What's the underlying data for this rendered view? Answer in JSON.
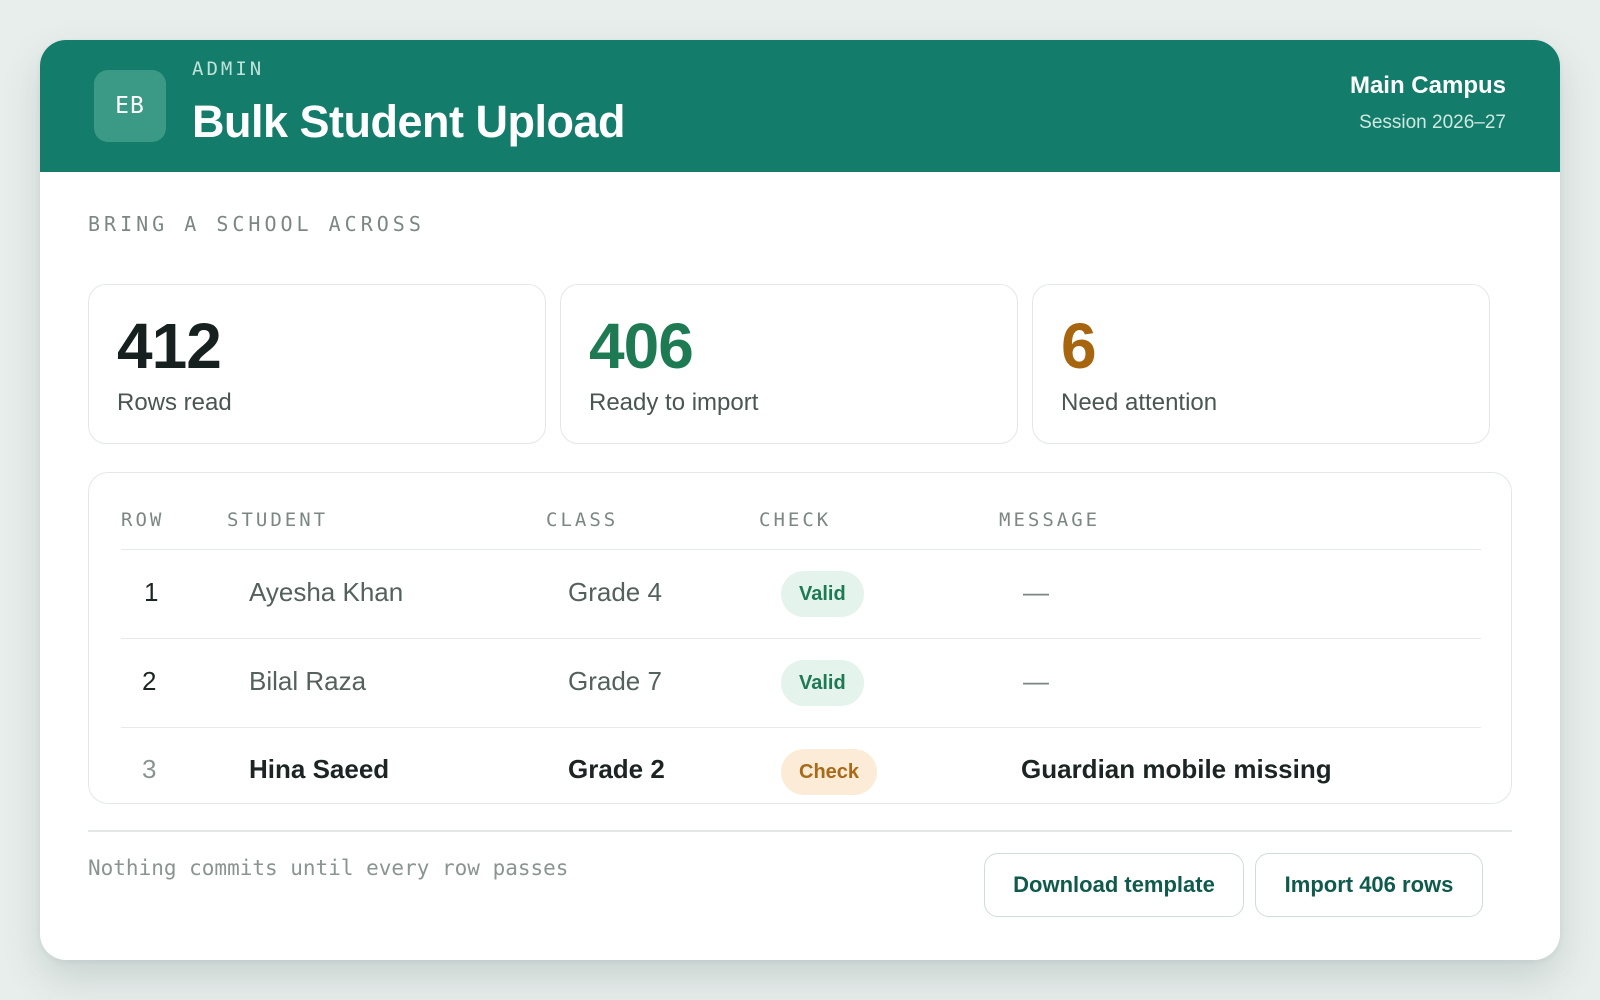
{
  "header": {
    "avatar_initials": "EB",
    "eyebrow": "ADMIN",
    "title": "Bulk Student Upload",
    "campus": "Main Campus",
    "session": "Session 2026–27",
    "color": "#137c6b"
  },
  "section_label": "BRING A SCHOOL ACROSS",
  "stats": [
    {
      "value": "412",
      "label": "Rows read",
      "color": "#16201e"
    },
    {
      "value": "406",
      "label": "Ready to import",
      "color": "#1e7a52"
    },
    {
      "value": "6",
      "label": "Need attention",
      "color": "#a8650f"
    }
  ],
  "table": {
    "columns": [
      "ROW",
      "STUDENT",
      "CLASS",
      "CHECK",
      "MESSAGE"
    ],
    "rows": [
      {
        "row": "1",
        "student": "Ayesha Khan",
        "class": "Grade 4",
        "check": "Valid",
        "message": "—"
      },
      {
        "row": "2",
        "student": "Bilal Raza",
        "class": "Grade 7",
        "check": "Valid",
        "message": "—"
      },
      {
        "row": "3",
        "student": "Hina Saeed",
        "class": "Grade 2",
        "check": "Check",
        "message": "Guardian mobile missing"
      }
    ]
  },
  "footer": {
    "note": "Nothing commits until every row passes",
    "download_label": "Download template",
    "import_label": "Import 406 rows"
  }
}
